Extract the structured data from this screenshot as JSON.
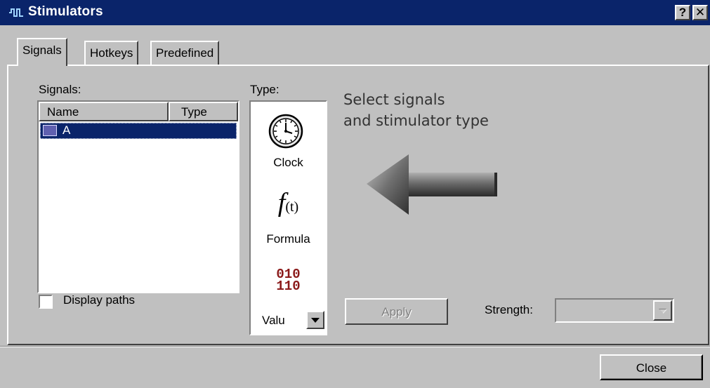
{
  "window": {
    "title": "Stimulators",
    "icon": "waveform-icon",
    "help_glyph": "?",
    "close_glyph": "✕"
  },
  "tabs": [
    {
      "label": "Signals",
      "active": true
    },
    {
      "label": "Hotkeys",
      "active": false
    },
    {
      "label": "Predefined",
      "active": false
    }
  ],
  "signals_panel": {
    "label": "Signals:",
    "columns": [
      "Name",
      "Type"
    ],
    "rows": [
      {
        "name": "A",
        "type": "",
        "selected": true
      }
    ],
    "display_paths_label": "Display paths",
    "display_paths_checked": false
  },
  "type_panel": {
    "label": "Type:",
    "items": [
      {
        "icon": "clock-icon",
        "label": "Clock"
      },
      {
        "icon": "formula-icon",
        "glyph_main": "f",
        "glyph_sub": "(t)",
        "label": "Formula"
      },
      {
        "icon": "binary-value-icon",
        "glyph_line1": "010",
        "glyph_line2": "110",
        "label": "Valu"
      }
    ]
  },
  "hint": {
    "line1": "Select signals",
    "line2": "and stimulator type",
    "icon": "arrow-left-icon"
  },
  "apply_label": "Apply",
  "apply_enabled": false,
  "strength": {
    "label": "Strength:",
    "value": "",
    "enabled": false
  },
  "close_label": "Close",
  "colors": {
    "titlebar": "#0a246a",
    "face": "#c0c0c0",
    "selection": "#0a246a",
    "value_icon": "#8b1a1a"
  }
}
